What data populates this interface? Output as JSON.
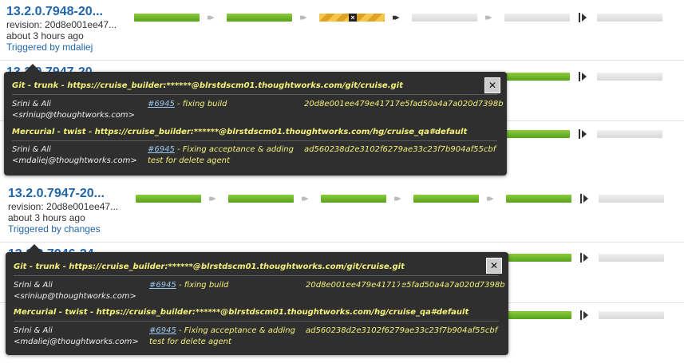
{
  "rows": [
    {
      "label": "13.2.0.7948-20...",
      "revision": "revision: 20d8e001ee47...",
      "age": "about 3 hours ago",
      "trigger": "Triggered by mdaliej"
    },
    {
      "label": "13.2.0.7947-20..."
    },
    {
      "label": "13.2.0.7947-20...",
      "revision": "revision: 20d8e001ee47...",
      "age": "about 3 hours ago",
      "trigger": "Triggered by changes"
    },
    {
      "label": "13.2.0.7946-24..."
    }
  ],
  "popups": [
    {
      "close": "✕",
      "materials": [
        {
          "header": "Git - trunk - https://cruise_builder:******@blrstdscm01.thoughtworks.com/git/cruise.git",
          "user_line1": "Srini & Ali",
          "user_line2": "<sriniup@thoughtworks.com>",
          "pipeline_link": "#6945",
          "comment": " - fixing build",
          "revision": "20d8e001ee479e41717e5fad50a4a7a020d7398b"
        },
        {
          "header": "Mercurial - twist - https://cruise_builder:******@blrstdscm01.thoughtworks.com/hg/cruise_qa#default",
          "user_line1": "Srini & Ali",
          "user_line2": "<mdaliej@thoughtworks.com>",
          "pipeline_link": "#6945",
          "comment": " - Fixing acceptance & adding test for delete agent",
          "revision": "ad560238d2e3102f6279ae33c23f7b904af55cbf"
        }
      ]
    },
    {
      "close": "✕",
      "materials": [
        {
          "header": "Git - trunk - https://cruise_builder:******@blrstdscm01.thoughtworks.com/git/cruise.git",
          "user_line1": "Srini & Ali",
          "user_line2": "<sriniup@thoughtworks.com>",
          "pipeline_link": "#6945",
          "comment": " - fixing build",
          "revision": "20d8e001ee479e41717e5fad50a4a7a020d7398b"
        },
        {
          "header": "Mercurial - twist - https://cruise_builder:******@blrstdscm01.thoughtworks.com/hg/cruise_qa#default",
          "user_line1": "Srini & Ali",
          "user_line2": "<mdaliej@thoughtworks.com>",
          "pipeline_link": "#6945",
          "comment": " - Fixing acceptance & adding test for delete agent",
          "revision": "ad560238d2e3102f6279ae33c23f7b904af55cbf"
        }
      ]
    }
  ],
  "stage_states": {
    "row0": [
      "passed",
      "passed",
      "building",
      "idle",
      "idle",
      "idle"
    ],
    "row2": [
      "passed",
      "passed",
      "passed",
      "passed",
      "passed",
      "idle"
    ]
  },
  "colors": {
    "link": "#2266aa",
    "passed": "#6db62a",
    "building": "#f2b531",
    "popup_bg": "#2f2f2f",
    "popup_text": "#f4f27a"
  },
  "arrow_glyph": "▸▸▸"
}
